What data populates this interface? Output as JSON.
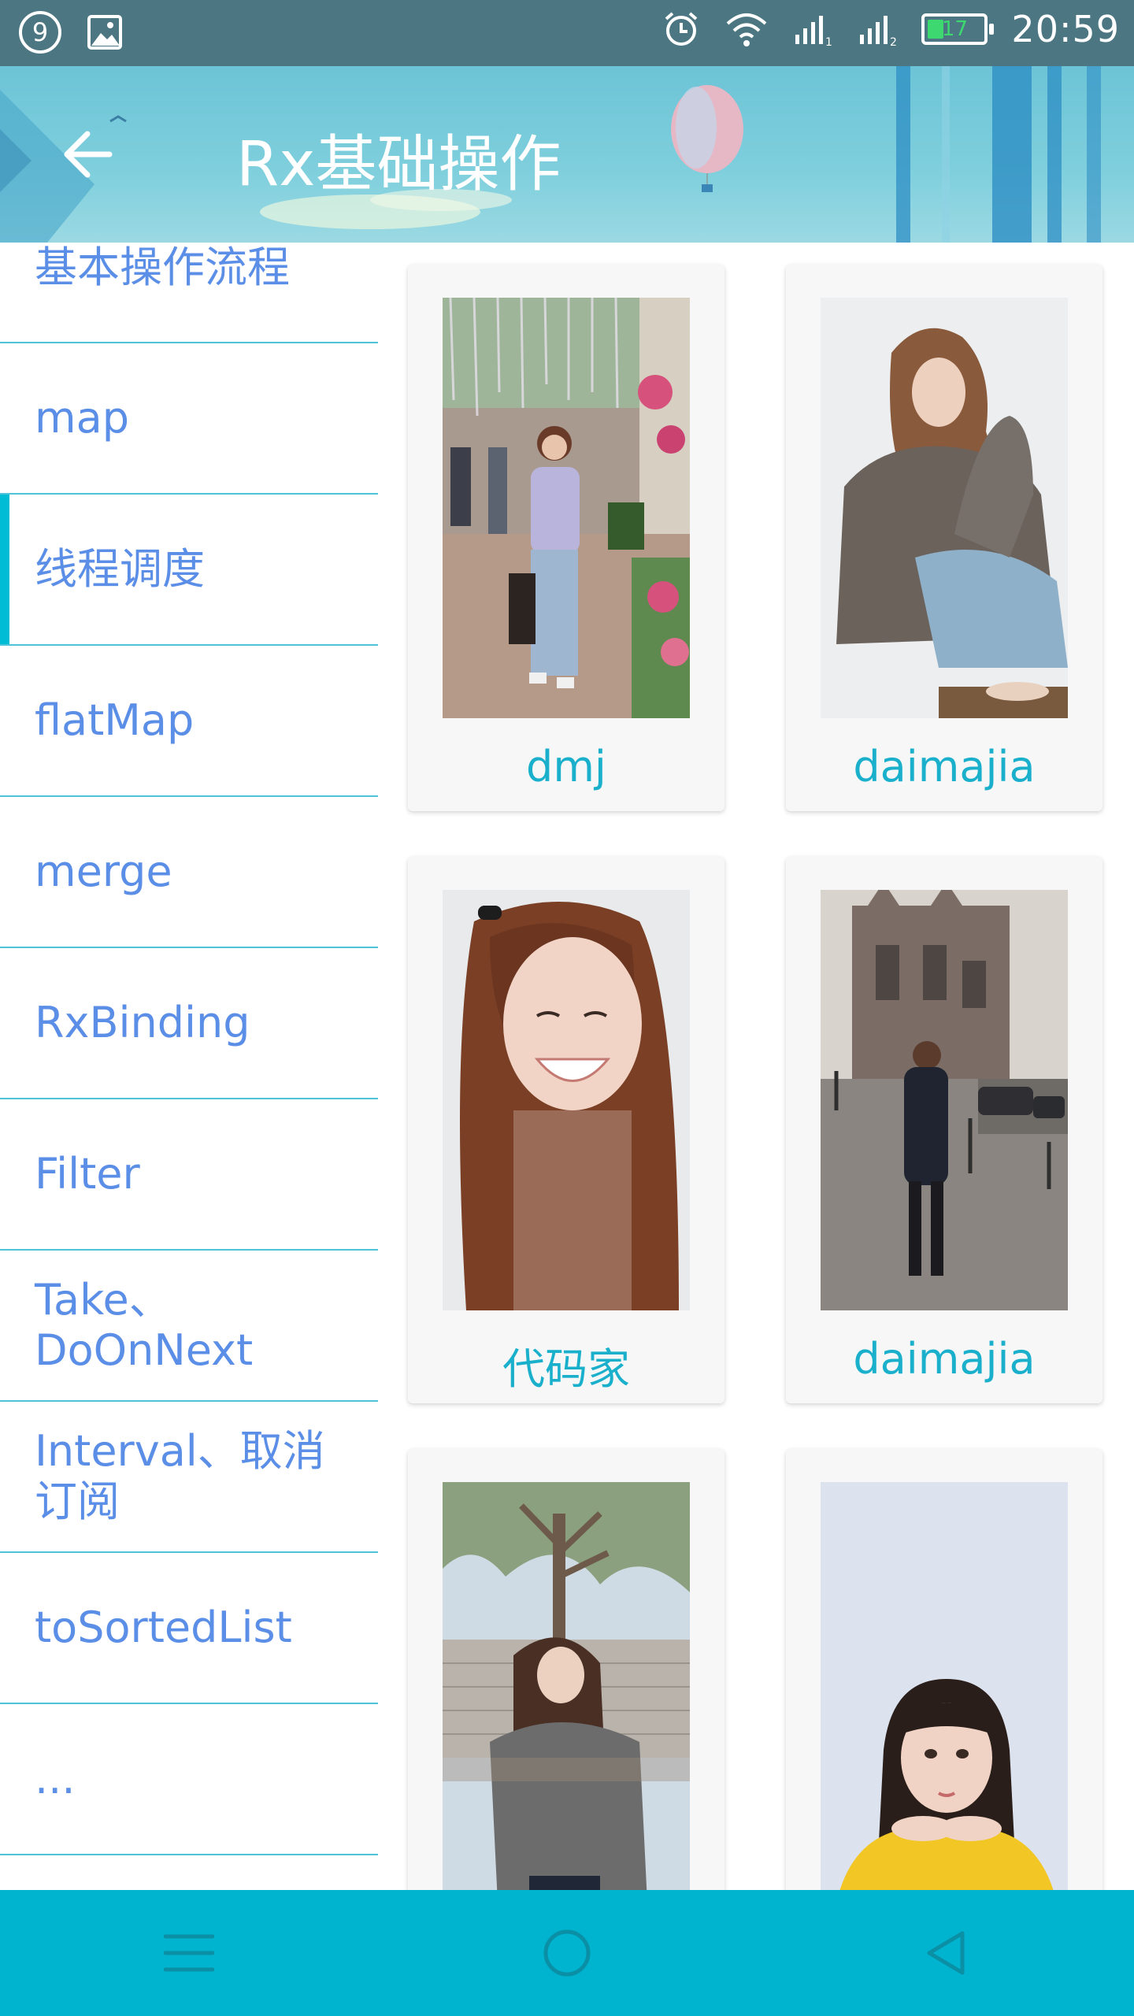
{
  "status_bar": {
    "notification_count": "9",
    "battery_level": "17",
    "time": "20:59",
    "icons": [
      "notification-count-icon",
      "gallery-icon",
      "alarm-icon",
      "wifi-icon",
      "signal-icon",
      "signal-2-icon",
      "battery-icon"
    ]
  },
  "toolbar": {
    "title": "Rx基础操作",
    "back_icon": "arrow-left-icon"
  },
  "nav": {
    "items": [
      {
        "label": "基本操作流程"
      },
      {
        "label": "map"
      },
      {
        "label": "线程调度",
        "selected": true
      },
      {
        "label": "flatMap"
      },
      {
        "label": "merge"
      },
      {
        "label": "RxBinding"
      },
      {
        "label": "Filter"
      },
      {
        "label": "Take、\nDoOnNext"
      },
      {
        "label": "Interval、取消\n订阅"
      },
      {
        "label": "toSortedList"
      },
      {
        "label": "..."
      }
    ]
  },
  "grid": {
    "cards": [
      {
        "caption": "dmj"
      },
      {
        "caption": "daimajia"
      },
      {
        "caption": "代码家"
      },
      {
        "caption": "daimajia"
      },
      {
        "caption": ""
      },
      {
        "caption": ""
      }
    ]
  },
  "bottom_nav": {
    "icons": [
      "menu-icon",
      "home-circle-icon",
      "back-triangle-icon"
    ]
  },
  "colors": {
    "accent": "#00bcd4",
    "nav_text": "#5b8ee6",
    "caption_text": "#1ab0cc",
    "divider": "#4fc3d9",
    "navbar": "#00b3cf"
  }
}
